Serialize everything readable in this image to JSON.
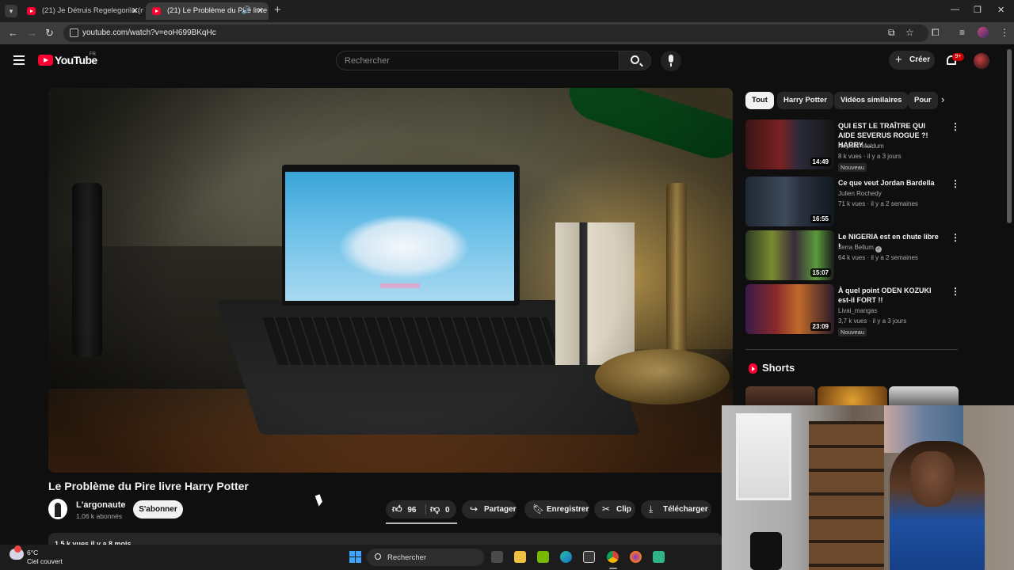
{
  "browser": {
    "tabs": [
      {
        "title": "(21) Je Détruis Regelegorila (ne",
        "active": false
      },
      {
        "title": "(21) Le Problème du Pire livre",
        "active": true
      }
    ],
    "url": "youtube.com/watch?v=eoH699BKqHc",
    "icons": [
      "tab-search-icon",
      "new-tab-icon",
      "minimize-icon",
      "maximize-icon",
      "close-icon",
      "back-icon",
      "forward-icon",
      "reload-icon",
      "site-info-icon",
      "cast-icon",
      "bookmark-star-icon",
      "extensions-icon",
      "reading-list-icon",
      "profile-icon",
      "menu-icon"
    ]
  },
  "youtube": {
    "logo_text": "YouTube",
    "country_code": "FR",
    "search_placeholder": "Rechercher",
    "create_label": "Créer",
    "notifications_badge": "9+",
    "brand_color": "#ff0033"
  },
  "video": {
    "title": "Le Problème du Pire livre Harry Potter",
    "channel": "L'argonaute",
    "subscribers": "1,06 k abonnés",
    "subscribe_label": "S'abonner",
    "likes": "96",
    "dislikes": "0",
    "actions": {
      "share": "Partager",
      "save": "Enregistrer",
      "clip": "Clip",
      "download": "Télécharger"
    },
    "description_peek": "1,5 k vues  il y a 8 mois"
  },
  "sidebar": {
    "chips": [
      "Tout",
      "Harry Potter",
      "Vidéos similaires",
      "Pour"
    ],
    "active_chip": 0,
    "recommendations": [
      {
        "title": "QUI EST LE TRAÎTRE QUI AIDE SEVERUS ROGUE ?! HARRY ...",
        "channel": "Repello Moldum",
        "meta": "8 k vues · il y a 3 jours",
        "duration": "14:49",
        "badge": "Nouveau",
        "verified": false
      },
      {
        "title": "Ce que veut Jordan Bardella",
        "channel": "Julien Rochedy",
        "meta": "71 k vues · il y a 2 semaines",
        "duration": "16:55",
        "badge": "",
        "verified": false
      },
      {
        "title": "Le NIGERIA est en chute libre !",
        "channel": "Terra Bellum",
        "meta": "64 k vues · il y a 2 semaines",
        "duration": "15:07",
        "badge": "",
        "verified": true
      },
      {
        "title": "À quel point ODEN KOZUKI est-il FORT !!",
        "channel": "Livai_mangas",
        "meta": "3,7 k vues · il y a 3 jours",
        "duration": "23:09",
        "badge": "Nouveau",
        "verified": false
      }
    ],
    "shorts_label": "Shorts"
  },
  "taskbar": {
    "temperature": "6°C",
    "weather": "Ciel couvert",
    "search_placeholder": "Rechercher",
    "apps": [
      "task-view-icon",
      "file-explorer-icon",
      "nvidia-icon",
      "edge-icon",
      "store-icon",
      "chrome-icon",
      "firefox-icon",
      "app-icon"
    ]
  }
}
